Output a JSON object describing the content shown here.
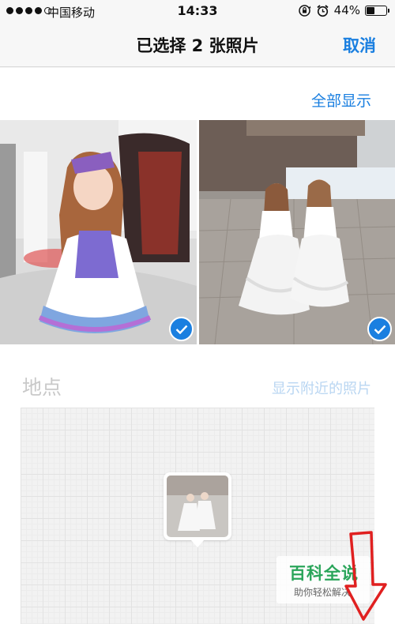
{
  "status_bar": {
    "carrier": "中国移动",
    "time": "14:33",
    "battery": "44%",
    "battery_level": 0.44
  },
  "nav": {
    "title": "已选择 2 张照片",
    "cancel": "取消"
  },
  "photos": {
    "show_all": "全部显示",
    "selected_count": 2
  },
  "location": {
    "label": "地点",
    "nearby": "显示附近的照片"
  },
  "watermark": {
    "title": "百科全说",
    "subtitle": "助你轻松解决"
  },
  "colors": {
    "accent": "#1a7fe0",
    "watermark_green": "#2aa55a",
    "annotation_red": "#e02020"
  }
}
